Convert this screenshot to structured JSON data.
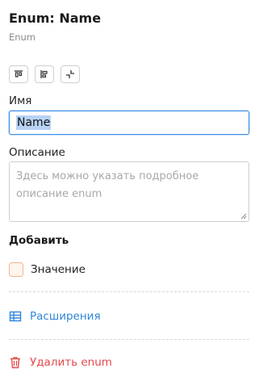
{
  "header": {
    "title": "Enum: Name",
    "subtitle": "Enum"
  },
  "toolbar": {
    "buttons": [
      {
        "icon": "align-top-icon"
      },
      {
        "icon": "align-left-icon"
      },
      {
        "icon": "collapse-icon"
      }
    ]
  },
  "fields": {
    "name_label": "Имя",
    "name_value": "Name",
    "description_label": "Описание",
    "description_placeholder": "Здесь можно указать подробное описание enum"
  },
  "add_section": {
    "title": "Добавить",
    "value_option": "Значение"
  },
  "actions": {
    "extensions_label": "Расширения",
    "delete_label": "Удалить enum"
  },
  "colors": {
    "accent": "#2f86d8",
    "danger": "#e5484d",
    "checkbox_border": "#f0b48a"
  }
}
